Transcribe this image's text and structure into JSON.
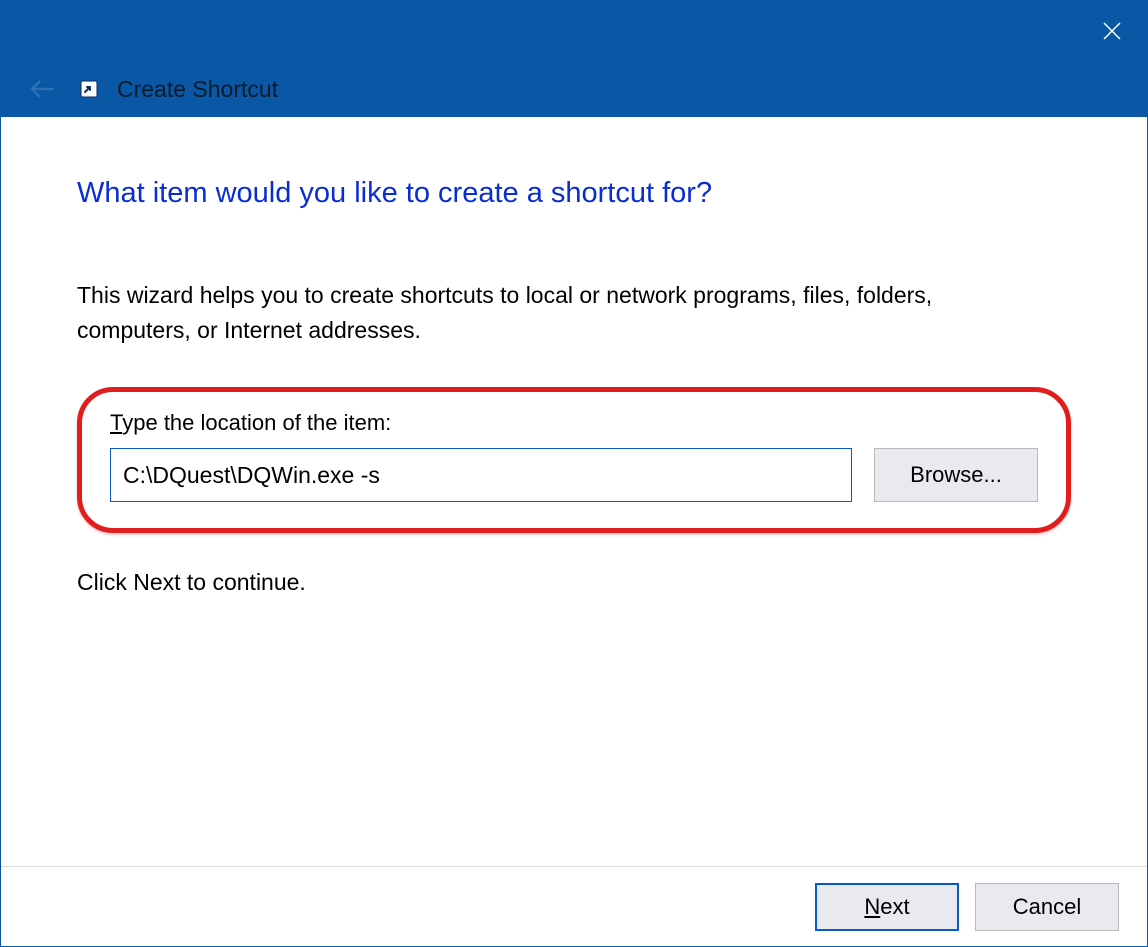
{
  "titlebar": {
    "close_label": "Close"
  },
  "nav": {
    "back_label": "Back",
    "title": "Create Shortcut"
  },
  "main": {
    "heading": "What item would you like to create a shortcut for?",
    "description": "This wizard helps you to create shortcuts to local or network programs, files, folders, computers, or Internet addresses.",
    "location_label_pre": "T",
    "location_label_rest": "ype the location of the item:",
    "location_value": "C:\\DQuest\\DQWin.exe -s",
    "browse_label": "Browse...",
    "continue_text": "Click Next to continue."
  },
  "footer": {
    "next_pre": "N",
    "next_rest": "ext",
    "cancel_label": "Cancel"
  }
}
